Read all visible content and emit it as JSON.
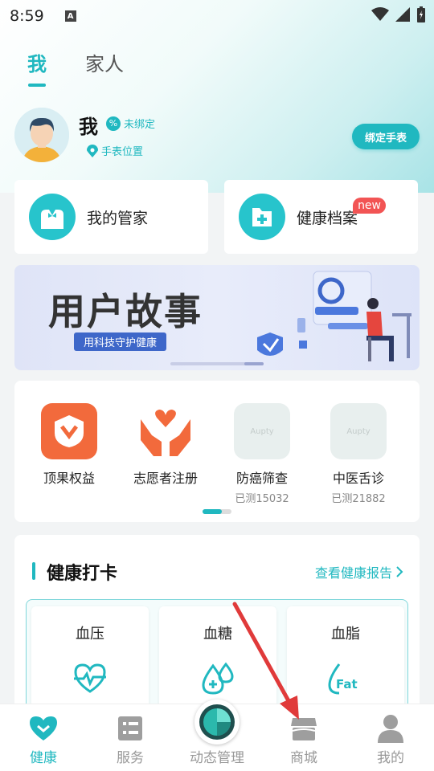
{
  "status_bar": {
    "time": "8:59",
    "notif_letter": "A"
  },
  "top_tabs": [
    {
      "label": "我",
      "active": true
    },
    {
      "label": "家人",
      "active": false
    }
  ],
  "profile": {
    "name": "我",
    "bind_status": "未绑定",
    "watch_location": "手表位置",
    "bind_button": "绑定手表"
  },
  "quick_cards": [
    {
      "label": "我的管家",
      "icon": "butler-icon"
    },
    {
      "label": "健康档案",
      "icon": "health-record-icon",
      "badge": "new"
    }
  ],
  "banner": {
    "title": "用户故事",
    "subtitle": "用科技守护健康"
  },
  "services": [
    {
      "name": "顶果权益",
      "count": "",
      "icon": "rights-badge-icon",
      "color": "#f26a3c"
    },
    {
      "name": "志愿者注册",
      "count": "",
      "icon": "volunteer-hands-icon",
      "color": "#f26a3c"
    },
    {
      "name": "防癌筛查",
      "count": "已测15032",
      "icon": "placeholder-icon",
      "placeholder": "Aupty"
    },
    {
      "name": "中医舌诊",
      "count": "已测21882",
      "icon": "placeholder-icon",
      "placeholder": "Aupty"
    }
  ],
  "checkin": {
    "title": "健康打卡",
    "report_link": "查看健康报告",
    "metrics": [
      {
        "label": "血压",
        "icon": "heart-pulse-icon"
      },
      {
        "label": "血糖",
        "icon": "blood-drop-icon"
      },
      {
        "label": "血脂",
        "icon": "fat-drop-icon",
        "icon_text": "Fat"
      }
    ]
  },
  "bottom_nav": [
    {
      "label": "健康",
      "active": true,
      "icon": "heart-icon"
    },
    {
      "label": "服务",
      "active": false,
      "icon": "service-list-icon"
    },
    {
      "label": "动态管理",
      "active": false,
      "icon": "dynamic-dial-icon"
    },
    {
      "label": "商城",
      "active": false,
      "icon": "store-icon"
    },
    {
      "label": "我的",
      "active": false,
      "icon": "person-icon"
    }
  ],
  "colors": {
    "accent": "#20b8c0",
    "orange": "#f26a3c",
    "badge_red": "#f25454",
    "annotation_arrow": "#e03a3a"
  }
}
